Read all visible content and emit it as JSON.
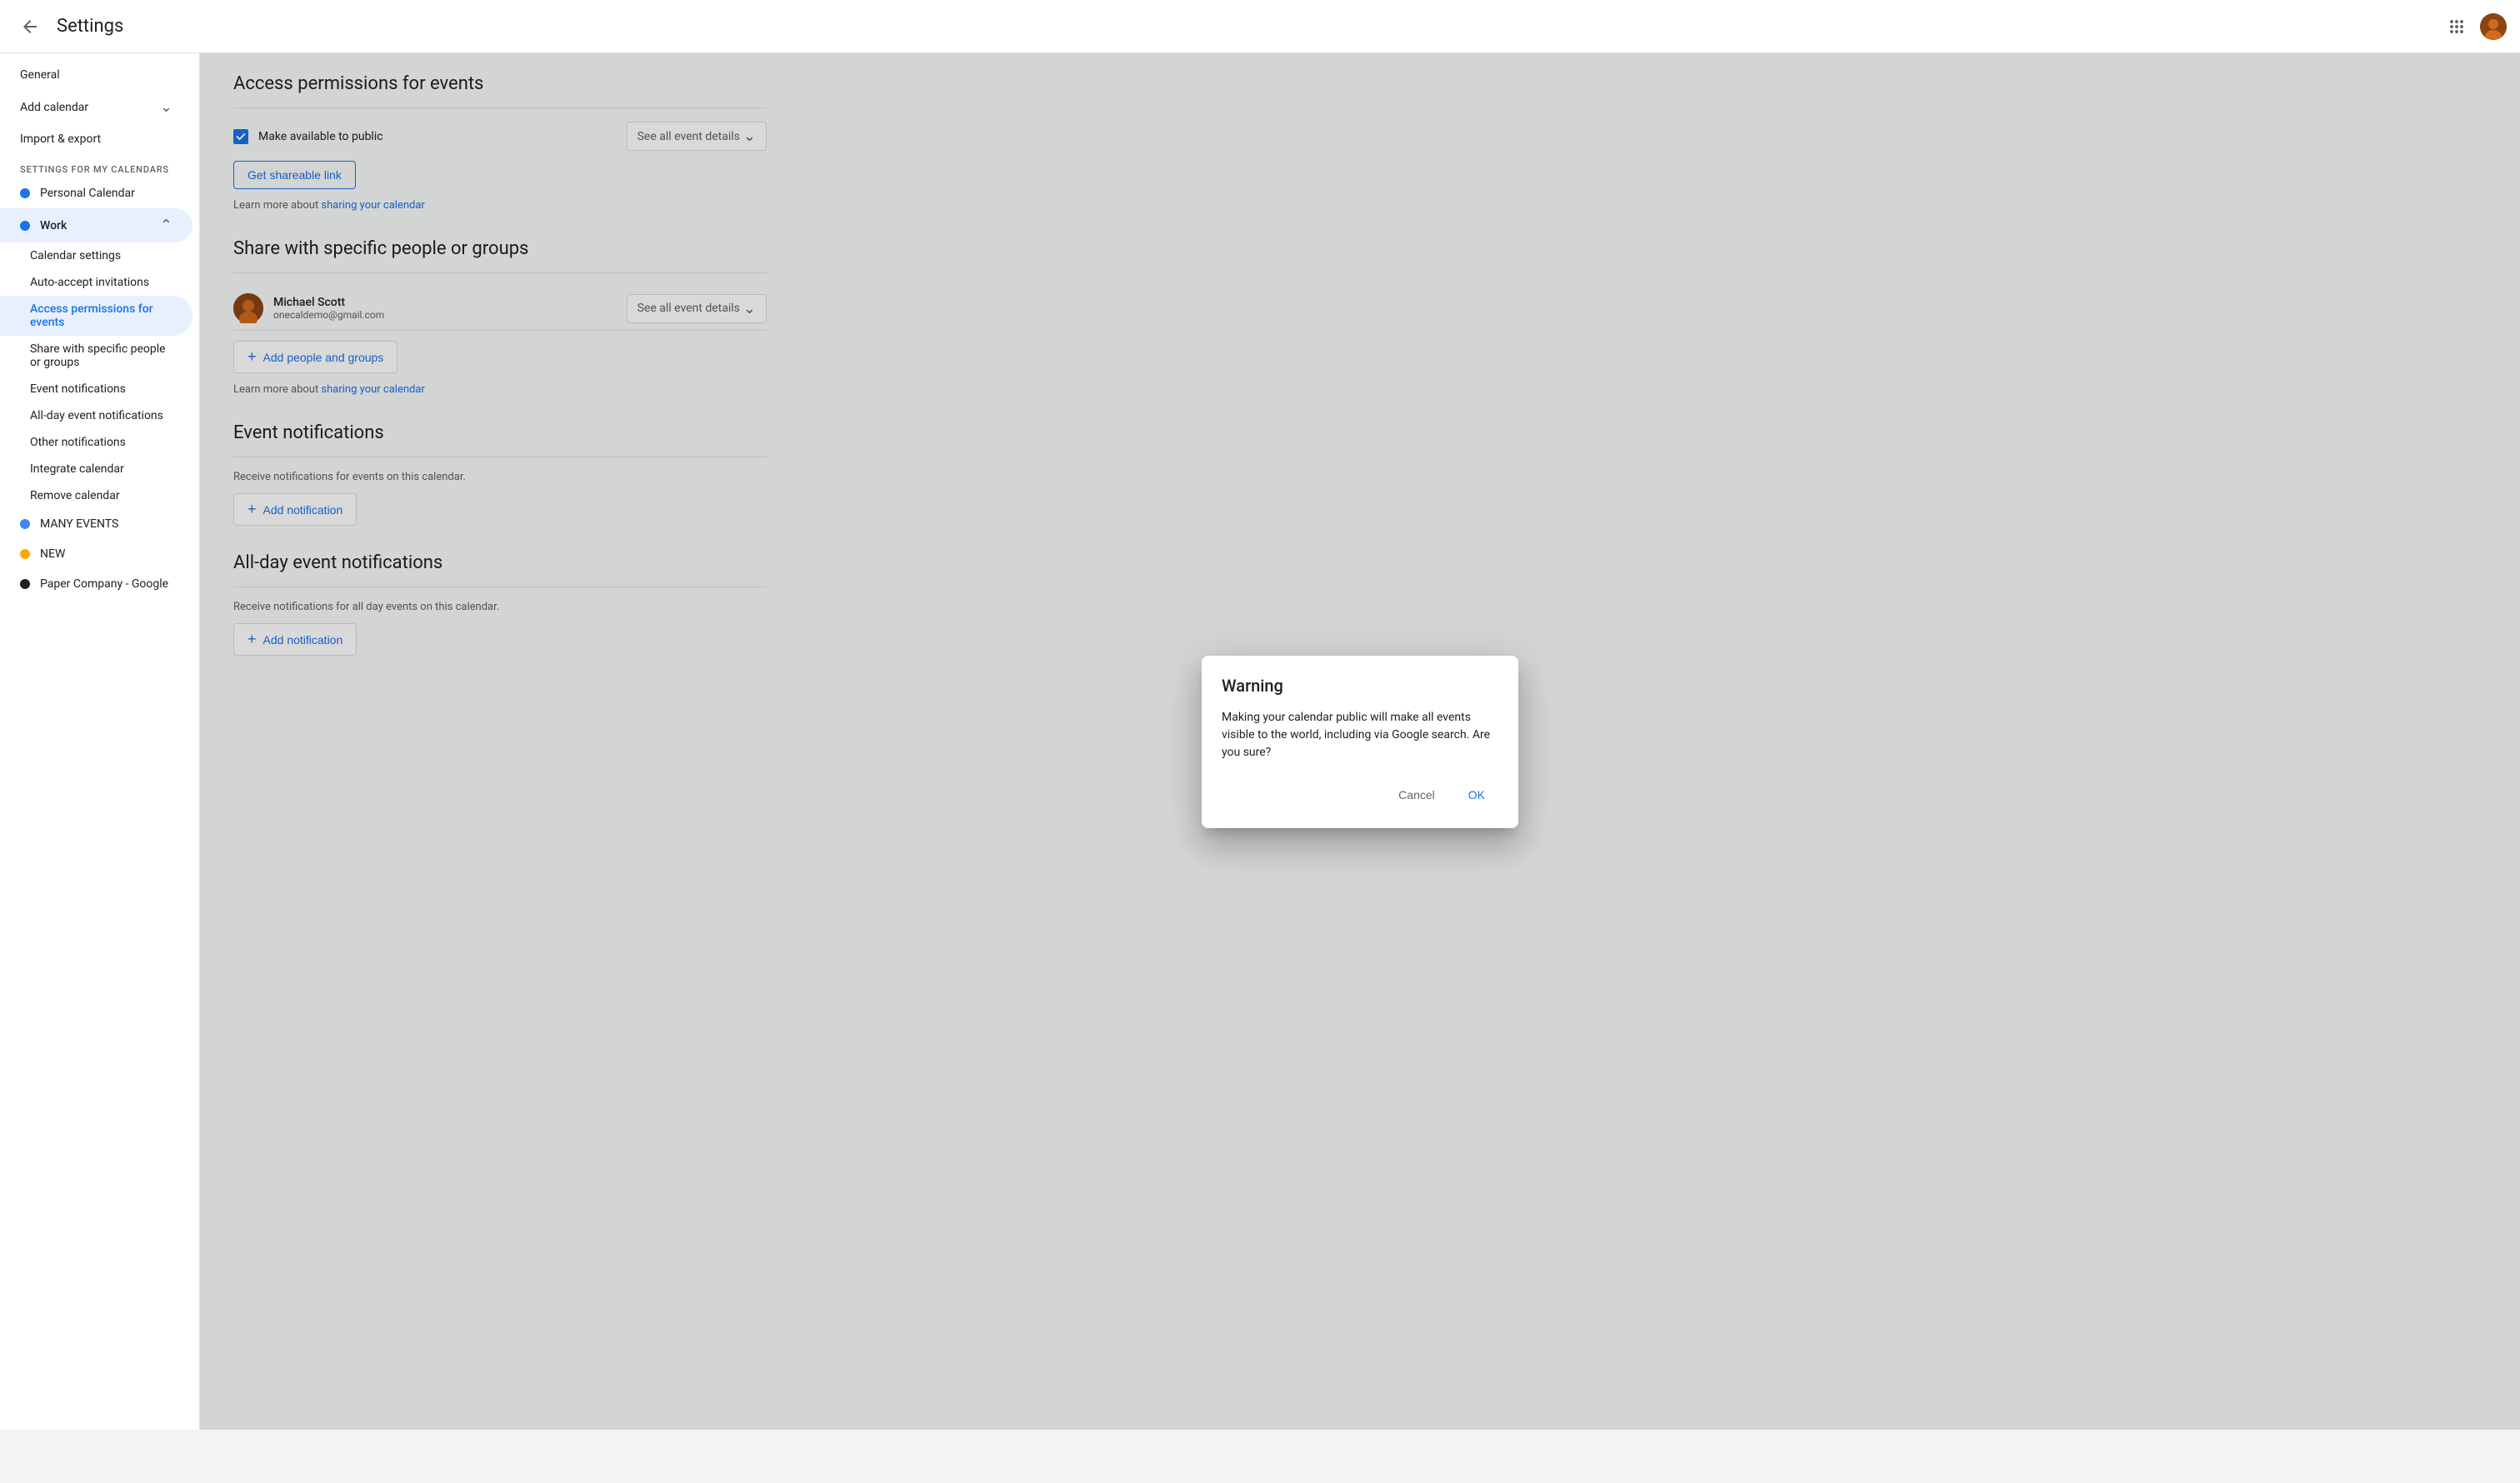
{
  "topbar": {
    "title": "Settings",
    "back_label": "←",
    "grid_icon": "⊞",
    "avatar_label": "User Avatar"
  },
  "sidebar": {
    "general_label": "General",
    "add_calendar_label": "Add calendar",
    "import_export_label": "Import & export",
    "settings_section": "Settings for my calendars",
    "personal_calendar_label": "Personal Calendar",
    "work_label": "Work",
    "calendar_settings_label": "Calendar settings",
    "auto_accept_label": "Auto-accept invitations",
    "access_permissions_label": "Access permissions for events",
    "share_label": "Share with specific people or groups",
    "event_notifications_label": "Event notifications",
    "allday_notifications_label": "All-day event notifications",
    "other_notifications_label": "Other notifications",
    "integrate_label": "Integrate calendar",
    "remove_label": "Remove calendar",
    "many_events_label": "MANY EVENTS",
    "new_label": "NEW",
    "paper_company_label": "Paper Company - Google",
    "dot_colors": {
      "personal": "#1a73e8",
      "work": "#1a73e8",
      "many_events": "#4285f4",
      "new_label": "#f9ab00",
      "paper_company": "#202124"
    }
  },
  "main": {
    "access_section": {
      "title": "Access permissions for events",
      "make_public_label": "Make available to public",
      "visibility_label": "See all event details",
      "get_link_label": "Get shareable link",
      "learn_more_prefix": "Learn more about ",
      "learn_more_link": "sharing your calendar"
    },
    "share_section": {
      "title": "Share with specific people or groups",
      "person_name": "Michael Scott",
      "person_email": "onecaldemo@gmail.com",
      "permission_label": "See all event details",
      "add_people_label": "Add people and groups",
      "learn_more_prefix": "Learn more about ",
      "learn_more_link": "sharing your calendar"
    },
    "event_notif_section": {
      "title": "Event notifications",
      "description": "Receive notifications for events on this calendar.",
      "add_notif_label": "Add notification"
    },
    "allday_section": {
      "title": "All-day event notifications",
      "description": "Receive notifications for all day events on this calendar.",
      "add_notif_label": "Add notification"
    }
  },
  "dialog": {
    "title": "Warning",
    "body": "Making your calendar public will make all events visible to the world, including via Google search. Are you sure?",
    "cancel_label": "Cancel",
    "ok_label": "OK"
  }
}
